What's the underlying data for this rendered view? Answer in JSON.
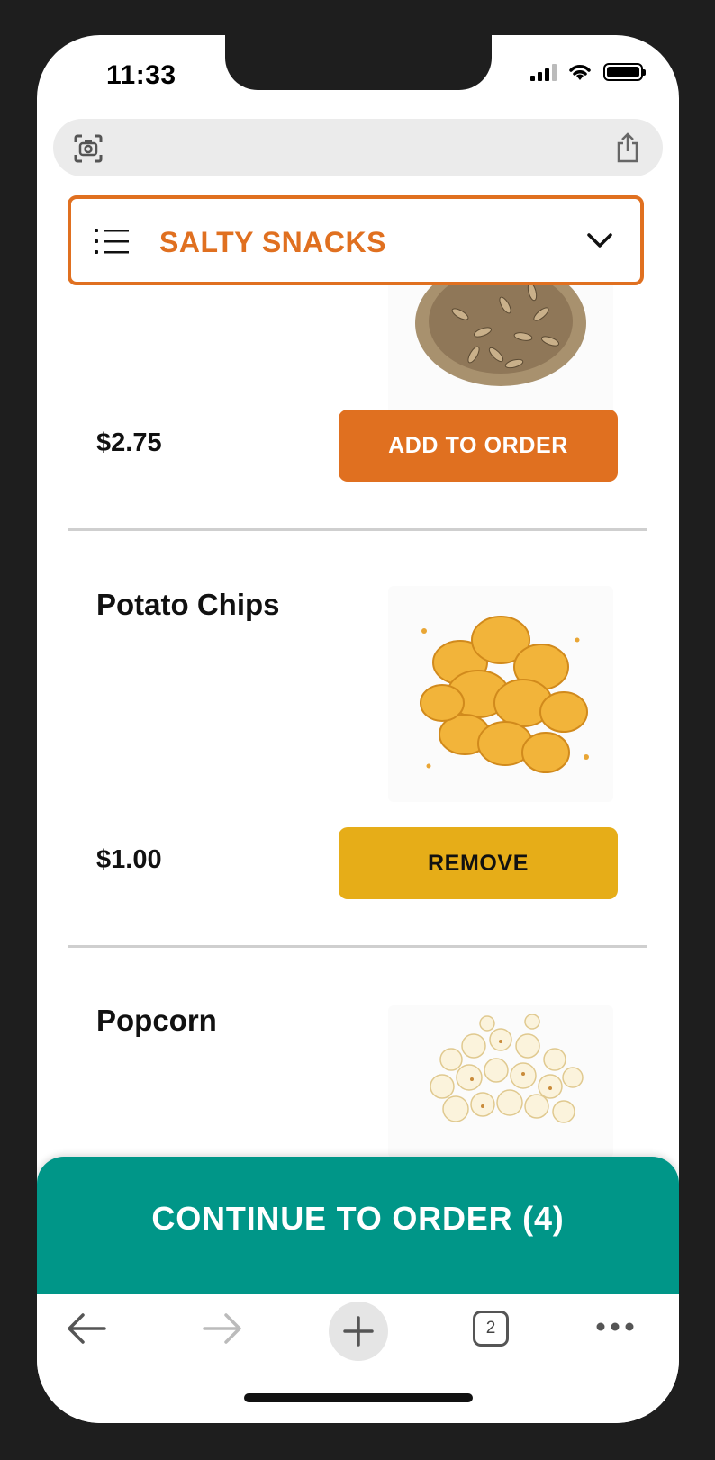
{
  "status_bar": {
    "time": "11:33"
  },
  "address_bar": {
    "lens_icon": "camera-search-icon",
    "share_icon": "share-icon"
  },
  "category_dropdown": {
    "label": "SALTY SNACKS",
    "menu_icon": "list-icon",
    "chevron_icon": "chevron-down-icon"
  },
  "items": [
    {
      "name": "",
      "price": "$2.75",
      "button_label": "ADD TO ORDER",
      "button_state": "add",
      "image": "sunflower-seeds-image"
    },
    {
      "name": "Potato Chips",
      "price": "$1.00",
      "button_label": "REMOVE",
      "button_state": "remove",
      "image": "potato-chips-image"
    },
    {
      "name": "Popcorn",
      "price": "",
      "button_label": "",
      "button_state": "",
      "image": "popcorn-image"
    }
  ],
  "continue_bar": {
    "label": "CONTINUE TO ORDER (4)"
  },
  "toolbar": {
    "tab_count": "2",
    "back_icon": "back-arrow-icon",
    "forward_icon": "forward-arrow-icon",
    "new_tab_icon": "plus-icon",
    "tabs_icon": "tabs-icon",
    "more_icon": "more-icon"
  },
  "colors": {
    "accent": "#e07020",
    "remove": "#e6ad18",
    "continue": "#009688"
  }
}
